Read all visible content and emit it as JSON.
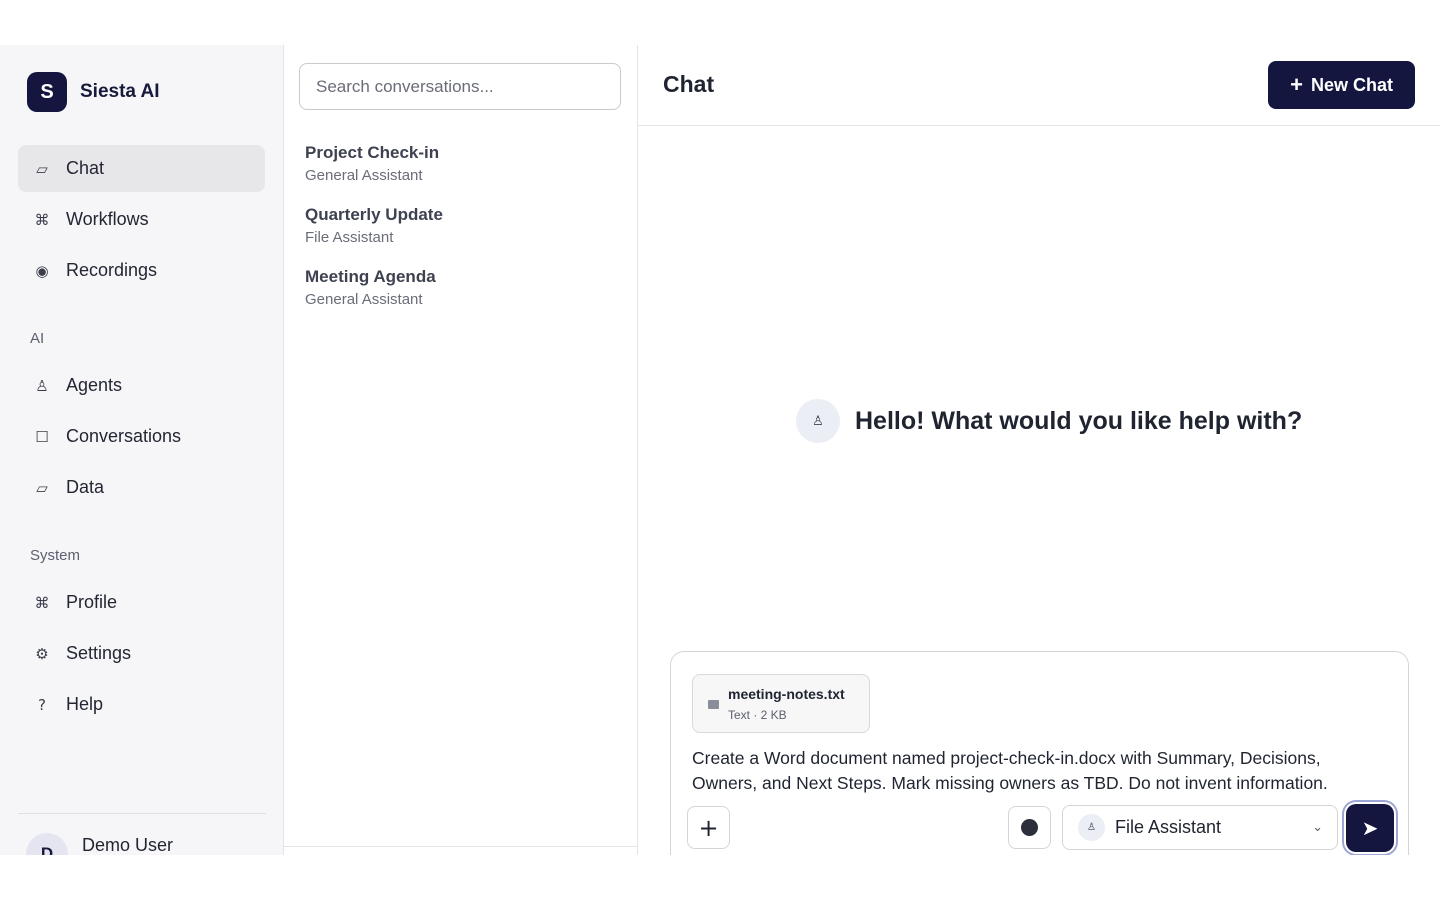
{
  "brand": {
    "logo_letter": "S",
    "name": "Siesta AI"
  },
  "sidebar": {
    "primary": [
      {
        "label": "Chat",
        "icon": "chat-icon",
        "glyph": "▱",
        "active": true
      },
      {
        "label": "Workflows",
        "icon": "command-icon",
        "glyph": "⌘",
        "active": false
      },
      {
        "label": "Recordings",
        "icon": "record-icon",
        "glyph": "◉",
        "active": false
      }
    ],
    "ai_section_label": "AI",
    "ai": [
      {
        "label": "Agents",
        "icon": "agent-icon",
        "glyph": "♙"
      },
      {
        "label": "Conversations",
        "icon": "square-icon",
        "glyph": "☐"
      },
      {
        "label": "Data",
        "icon": "data-icon",
        "glyph": "▱"
      }
    ],
    "system_section_label": "System",
    "system": [
      {
        "label": "Profile",
        "icon": "command-icon",
        "glyph": "⌘"
      },
      {
        "label": "Settings",
        "icon": "gear-icon",
        "glyph": "⚙"
      },
      {
        "label": "Help",
        "icon": "help-icon",
        "glyph": "?"
      }
    ],
    "user": {
      "initial": "D",
      "name": "Demo User"
    }
  },
  "conversations": {
    "search_placeholder": "Search conversations...",
    "items": [
      {
        "title": "Project Check-in",
        "agent": "General Assistant"
      },
      {
        "title": "Quarterly Update",
        "agent": "File Assistant"
      },
      {
        "title": "Meeting Agenda",
        "agent": "General Assistant"
      }
    ]
  },
  "main": {
    "title": "Chat",
    "new_chat_plus": "+",
    "new_chat_label": "New Chat",
    "greeting": "Hello! What would you like help with?",
    "greeting_glyph": "♙"
  },
  "composer": {
    "attachment": {
      "name": "meeting-notes.txt",
      "meta": "Text · 2 KB"
    },
    "text": "Create a Word document named project-check-in.docx with Summary, Decisions, Owners, and Next Steps. Mark missing owners as TBD. Do not invent information.",
    "attach_glyph": "+",
    "agent": {
      "label": "File Assistant",
      "glyph": "♙",
      "chevron": "⌄"
    },
    "send_glyph": "➤"
  },
  "colors": {
    "brand_navy": "#15163f",
    "sidebar_bg": "#f6f6f8",
    "active_item": "#e7e7ea"
  }
}
